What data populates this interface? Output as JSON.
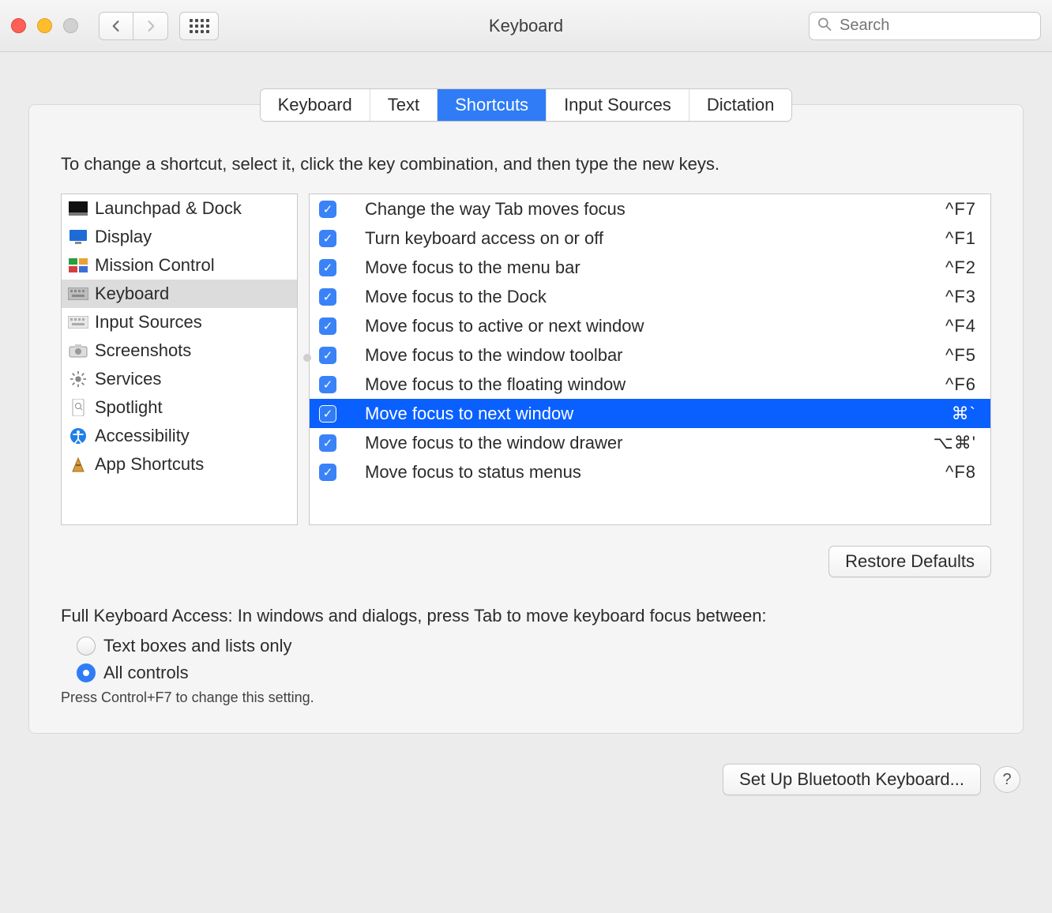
{
  "window": {
    "title": "Keyboard"
  },
  "search": {
    "placeholder": "Search"
  },
  "tabs": {
    "keyboard": "Keyboard",
    "text": "Text",
    "shortcuts": "Shortcuts",
    "input_sources": "Input Sources",
    "dictation": "Dictation",
    "selected": "shortcuts"
  },
  "panel": {
    "instruction": "To change a shortcut, select it, click the key combination, and then type the new keys.",
    "categories": [
      {
        "label": "Launchpad & Dock",
        "icon": "launchpad",
        "selected": false
      },
      {
        "label": "Display",
        "icon": "display",
        "selected": false
      },
      {
        "label": "Mission Control",
        "icon": "mission",
        "selected": false
      },
      {
        "label": "Keyboard",
        "icon": "keyboard",
        "selected": true
      },
      {
        "label": "Input Sources",
        "icon": "input",
        "selected": false
      },
      {
        "label": "Screenshots",
        "icon": "camera",
        "selected": false
      },
      {
        "label": "Services",
        "icon": "gear",
        "selected": false
      },
      {
        "label": "Spotlight",
        "icon": "spotlight",
        "selected": false
      },
      {
        "label": "Accessibility",
        "icon": "accessibility",
        "selected": false
      },
      {
        "label": "App Shortcuts",
        "icon": "app",
        "selected": false
      }
    ],
    "shortcuts": [
      {
        "enabled": true,
        "label": "Change the way Tab moves focus",
        "key": "^F7",
        "selected": false
      },
      {
        "enabled": true,
        "label": "Turn keyboard access on or off",
        "key": "^F1",
        "selected": false
      },
      {
        "enabled": true,
        "label": "Move focus to the menu bar",
        "key": "^F2",
        "selected": false
      },
      {
        "enabled": true,
        "label": "Move focus to the Dock",
        "key": "^F3",
        "selected": false
      },
      {
        "enabled": true,
        "label": "Move focus to active or next window",
        "key": "^F4",
        "selected": false
      },
      {
        "enabled": true,
        "label": "Move focus to the window toolbar",
        "key": "^F5",
        "selected": false
      },
      {
        "enabled": true,
        "label": "Move focus to the floating window",
        "key": "^F6",
        "selected": false
      },
      {
        "enabled": true,
        "label": "Move focus to next window",
        "key": "⌘`",
        "selected": true
      },
      {
        "enabled": true,
        "label": "Move focus to the window drawer",
        "key": "⌥⌘'",
        "selected": false
      },
      {
        "enabled": true,
        "label": "Move focus to status menus",
        "key": "^F8",
        "selected": false
      }
    ],
    "restore_defaults": "Restore Defaults",
    "fka_label": "Full Keyboard Access: In windows and dialogs, press Tab to move keyboard focus between:",
    "fka_options": {
      "text_boxes": "Text boxes and lists only",
      "all_controls": "All controls",
      "selected": "all_controls"
    },
    "fka_hint": "Press Control+F7 to change this setting."
  },
  "footer": {
    "bluetooth": "Set Up Bluetooth Keyboard..."
  }
}
